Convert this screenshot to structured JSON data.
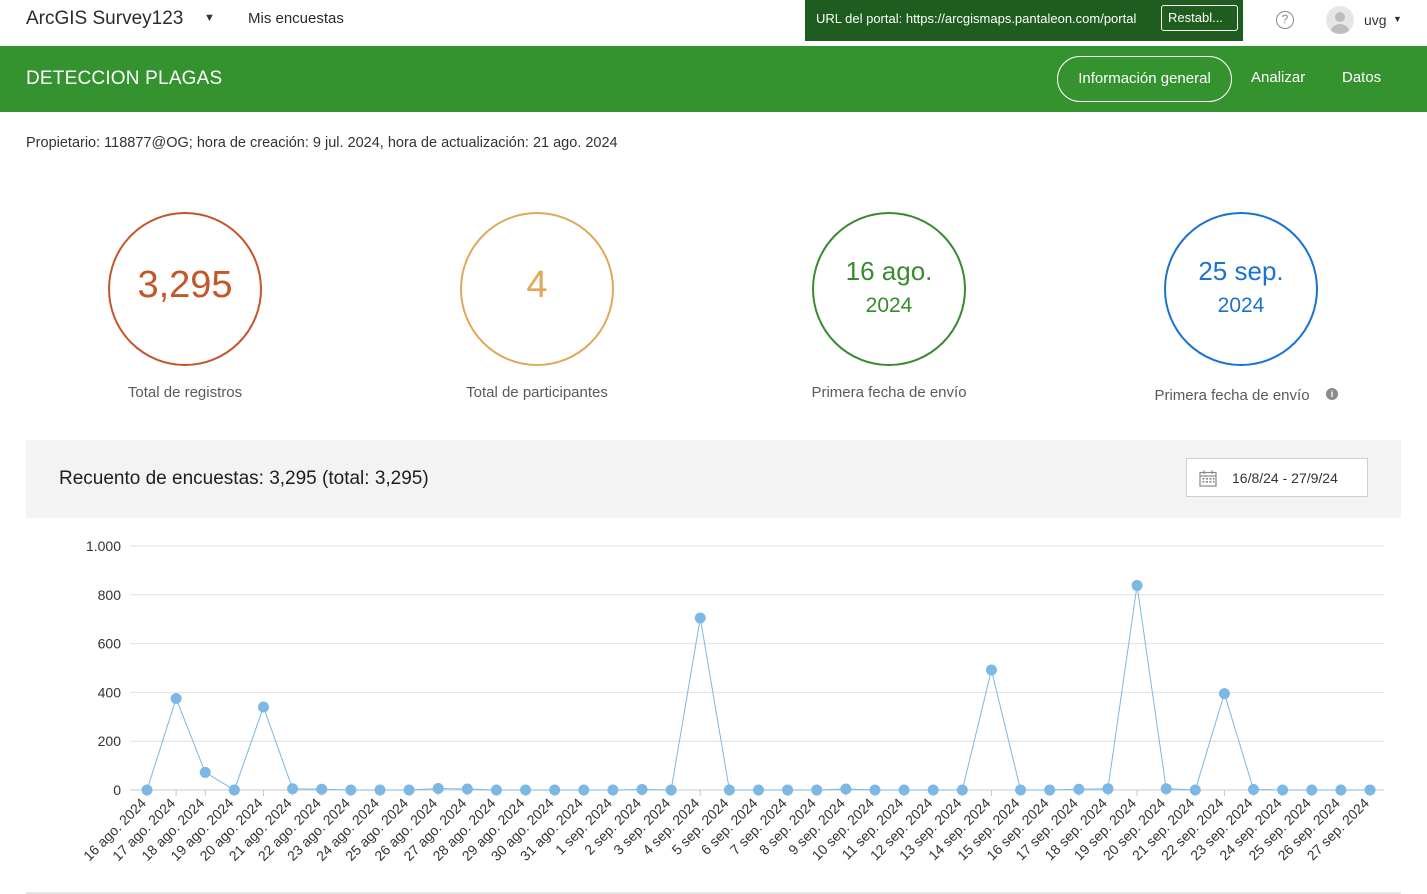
{
  "topbar": {
    "app_title": "ArcGIS Survey123",
    "my_surveys": "Mis encuestas",
    "portal_label": "URL del portal: https://arcgismaps.pantaleon.com/portal",
    "portal_reset": "Restabl...",
    "help_icon": "question-circle-icon",
    "user_name": "uvg"
  },
  "header": {
    "survey_name": "DETECCION PLAGAS",
    "tabs": [
      {
        "label": "Información general",
        "active": true
      },
      {
        "label": "Analizar",
        "active": false
      },
      {
        "label": "Datos",
        "active": false
      }
    ],
    "color": "#35932f"
  },
  "meta": "Propietario: 118877@OG; hora de creación: 9 jul. 2024, hora de actualización: 21 ago. 2024",
  "stats": {
    "total_records": {
      "value": "3,295",
      "label": "Total de registros",
      "color": "#c4572a"
    },
    "total_participants": {
      "value": "4",
      "label": "Total de participantes",
      "color": "#e0a95a"
    },
    "first_date": {
      "line1": "16 ago.",
      "line2": "2024",
      "label": "Primera fecha de envío",
      "color": "#3a8a32"
    },
    "last_date": {
      "line1": "25 sep.",
      "line2": "2024",
      "label": "Primera fecha de envío",
      "color": "#1a73d0"
    }
  },
  "chart_panel": {
    "title": "Recuento de encuestas: 3,295 (total: 3,295)",
    "date_range": "16/8/24 - 27/9/24"
  },
  "chart_data": {
    "type": "line",
    "ylim": [
      0,
      1000
    ],
    "yticks": [
      "0",
      "200",
      "400",
      "600",
      "800",
      "1.000"
    ],
    "ytick_values": [
      0,
      200,
      400,
      600,
      800,
      1000
    ],
    "series_color": "#7db7e3",
    "categories": [
      "16 ago. 2024",
      "17 ago. 2024",
      "18 ago. 2024",
      "19 ago. 2024",
      "20 ago. 2024",
      "21 ago. 2024",
      "22 ago. 2024",
      "23 ago. 2024",
      "24 ago. 2024",
      "25 ago. 2024",
      "26 ago. 2024",
      "27 ago. 2024",
      "28 ago. 2024",
      "29 ago. 2024",
      "30 ago. 2024",
      "31 ago. 2024",
      "1 sep. 2024",
      "2 sep. 2024",
      "3 sep. 2024",
      "4 sep. 2024",
      "5 sep. 2024",
      "6 sep. 2024",
      "7 sep. 2024",
      "8 sep. 2024",
      "9 sep. 2024",
      "10 sep. 2024",
      "11 sep. 2024",
      "12 sep. 2024",
      "13 sep. 2024",
      "14 sep. 2024",
      "15 sep. 2024",
      "16 sep. 2024",
      "17 sep. 2024",
      "18 sep. 2024",
      "19 sep. 2024",
      "20 sep. 2024",
      "21 sep. 2024",
      "22 sep. 2024",
      "23 sep. 2024",
      "24 sep. 2024",
      "25 sep. 2024",
      "26 sep. 2024",
      "27 sep. 2024"
    ],
    "values": [
      0,
      375,
      72,
      0,
      340,
      5,
      3,
      0,
      0,
      0,
      6,
      4,
      0,
      0,
      0,
      0,
      0,
      2,
      0,
      705,
      0,
      0,
      0,
      0,
      4,
      0,
      0,
      0,
      0,
      492,
      0,
      0,
      3,
      5,
      838,
      5,
      0,
      395,
      2,
      0,
      0,
      0,
      0
    ]
  }
}
